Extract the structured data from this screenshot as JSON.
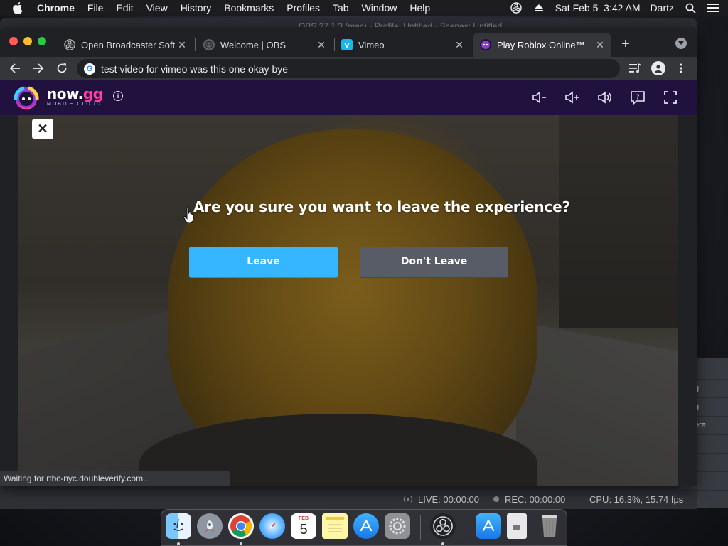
{
  "menubar": {
    "app": "Chrome",
    "items": [
      "File",
      "Edit",
      "View",
      "History",
      "Bookmarks",
      "Profiles",
      "Tab",
      "Window",
      "Help"
    ],
    "datetime": "Sat Feb 5  3:42 AM",
    "user": "Dartz"
  },
  "obs": {
    "title": "OBS 27.1.3 (mac) - Profile: Untitled - Scenes: Untitled",
    "side_rows": [
      "g",
      "g",
      "era",
      "",
      "",
      ""
    ],
    "live": "LIVE: 00:00:00",
    "rec": "REC: 00:00:00",
    "cpu": "CPU: 16.3%, 15.74 fps"
  },
  "chrome": {
    "tabs": [
      {
        "label": "Open Broadcaster Soft",
        "icon": "obs-icon"
      },
      {
        "label": "Welcome | OBS",
        "icon": "globe-icon"
      },
      {
        "label": "Vimeo",
        "icon": "vimeo-icon"
      },
      {
        "label": "Play Roblox Online™",
        "icon": "nowgg-icon",
        "active": true
      }
    ],
    "omnibox_text": "test video for vimeo was this one okay bye",
    "status": "Waiting for rtbc-nyc.doubleverify.com..."
  },
  "nowgg": {
    "wordmark_a": "now.",
    "wordmark_b": "gg",
    "sub": "MOBILE CLOUD",
    "info": "i"
  },
  "game": {
    "close": "✕",
    "question": "Are you sure you want to leave the experience?",
    "leave_label": "Leave",
    "dont_leave_label": "Don't Leave"
  },
  "dock": {
    "calendar_month": "FEB",
    "calendar_day": "5"
  },
  "colors": {
    "nowgg_bar": "#20113f",
    "leave_button": "#35b6ff",
    "dont_leave_button": "#585c66"
  }
}
